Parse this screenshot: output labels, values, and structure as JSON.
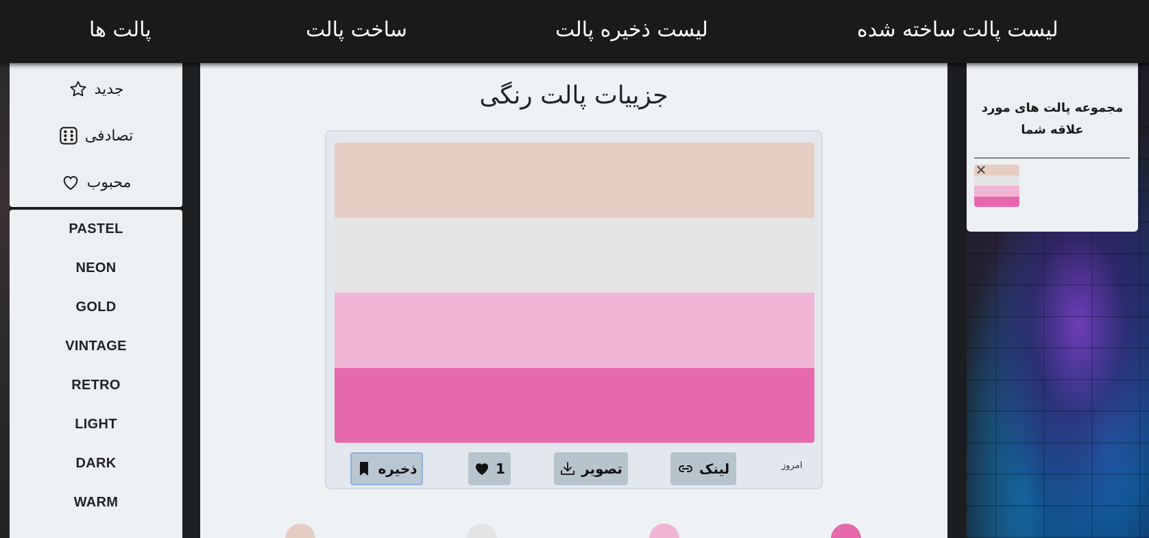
{
  "nav": {
    "palettes": "پالت ها",
    "create": "ساخت پالت",
    "saved_list": "لیست ذخیره پالت",
    "created_list": "لیست پالت ساخته شده"
  },
  "sidebar": {
    "items": [
      {
        "label": "جدید",
        "icon": "star-icon"
      },
      {
        "label": "تصادفی",
        "icon": "dice-icon"
      },
      {
        "label": "محبوب",
        "icon": "heart-icon"
      }
    ],
    "categories": [
      "PASTEL",
      "NEON",
      "GOLD",
      "VINTAGE",
      "RETRO",
      "LIGHT",
      "DARK",
      "WARM"
    ]
  },
  "main": {
    "title": "جزییات پالت رنگی",
    "palette_colors": [
      "#e6cdc3",
      "#e5e4e4",
      "#f0b5d5",
      "#e669ad"
    ],
    "actions": {
      "save": "ذخیره",
      "likes": "1",
      "image": "تصویر",
      "link": "لینک",
      "date": "امروز"
    }
  },
  "favorites": {
    "title": "مجموعه پالت های مورد علاقه شما",
    "remove_symbol": "✕",
    "thumb_colors": [
      "#e6cdc3",
      "#e5e4e4",
      "#f0b5d5",
      "#e669ad"
    ]
  },
  "colors": {
    "nav_bg": "#1a1a1a",
    "panel_bg": "#edf0f3",
    "button_bg": "#b8c4cc"
  }
}
